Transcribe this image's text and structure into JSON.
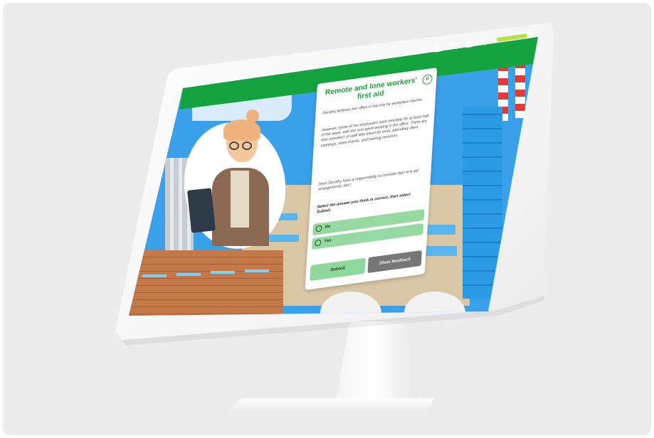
{
  "toolbar": {
    "icons": [
      "volume-icon",
      "briefcase-icon",
      "search-icon",
      "book-icon",
      "help-icon"
    ],
    "help_glyph": "?",
    "progress": 0.85,
    "colors": {
      "bar": "#15a33f",
      "progress_fill": "#b6e341"
    }
  },
  "question": {
    "title": "Remote and lone workers' first aid",
    "paragraphs": [
      "Dorothy believes her office is low-risk for workplace injuries.",
      "However, some of her employees work remotely for at least half of the week, with the rest spent working in the office. There are also members of staff who travel for work, attending client meetings, sales events, and training sessions.",
      "Does Dorothy have a responsibility to consider their first aid arrangements, too?"
    ],
    "instruction": "Select the answer you think is correct, then select Submit.",
    "options": [
      "No",
      "Yes"
    ],
    "submit_label": "Submit",
    "feedback_label": "Show feedback",
    "accent": "#1f9f3c"
  }
}
